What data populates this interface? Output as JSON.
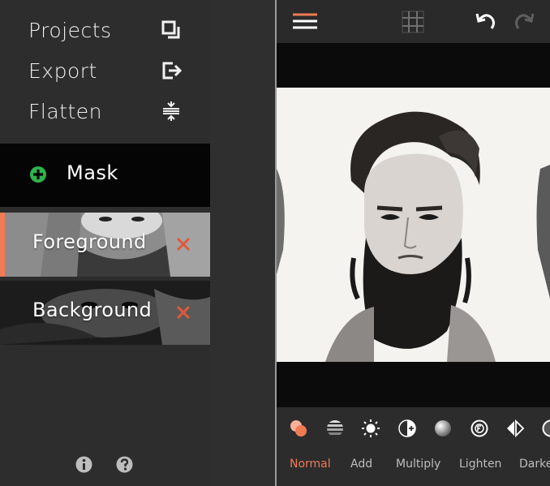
{
  "sidebar": {
    "menu": [
      {
        "label": "Projects",
        "icon": "projects-icon"
      },
      {
        "label": "Export",
        "icon": "export-icon"
      },
      {
        "label": "Flatten",
        "icon": "flatten-icon"
      }
    ],
    "mask": {
      "label": "Mask",
      "icon": "add-circle-icon"
    },
    "layers": [
      {
        "label": "Foreground",
        "selected": true,
        "delete_icon": "close-icon"
      },
      {
        "label": "Background",
        "selected": false,
        "delete_icon": "close-icon"
      }
    ],
    "footer_icons": [
      "info-icon",
      "help-icon"
    ]
  },
  "toolbar": {
    "icons": [
      "menu-icon",
      "grid-icon",
      "undo-icon",
      "redo-icon"
    ]
  },
  "blend_modes": {
    "items": [
      {
        "label": "Normal",
        "icon": "normal-blend-icon",
        "active": true
      },
      {
        "label": "Add",
        "icon": "add-blend-icon",
        "active": false
      },
      {
        "label": "Multiply",
        "icon": "multiply-blend-icon",
        "active": false
      },
      {
        "label": "Lighten",
        "icon": "lighten-blend-icon",
        "active": false
      },
      {
        "label": "Darke",
        "icon": "darken-blend-icon",
        "active": false
      }
    ]
  },
  "colors": {
    "accent": "#f07b52",
    "mask_plus": "#2fb34a",
    "delete_x": "#e0583a"
  }
}
